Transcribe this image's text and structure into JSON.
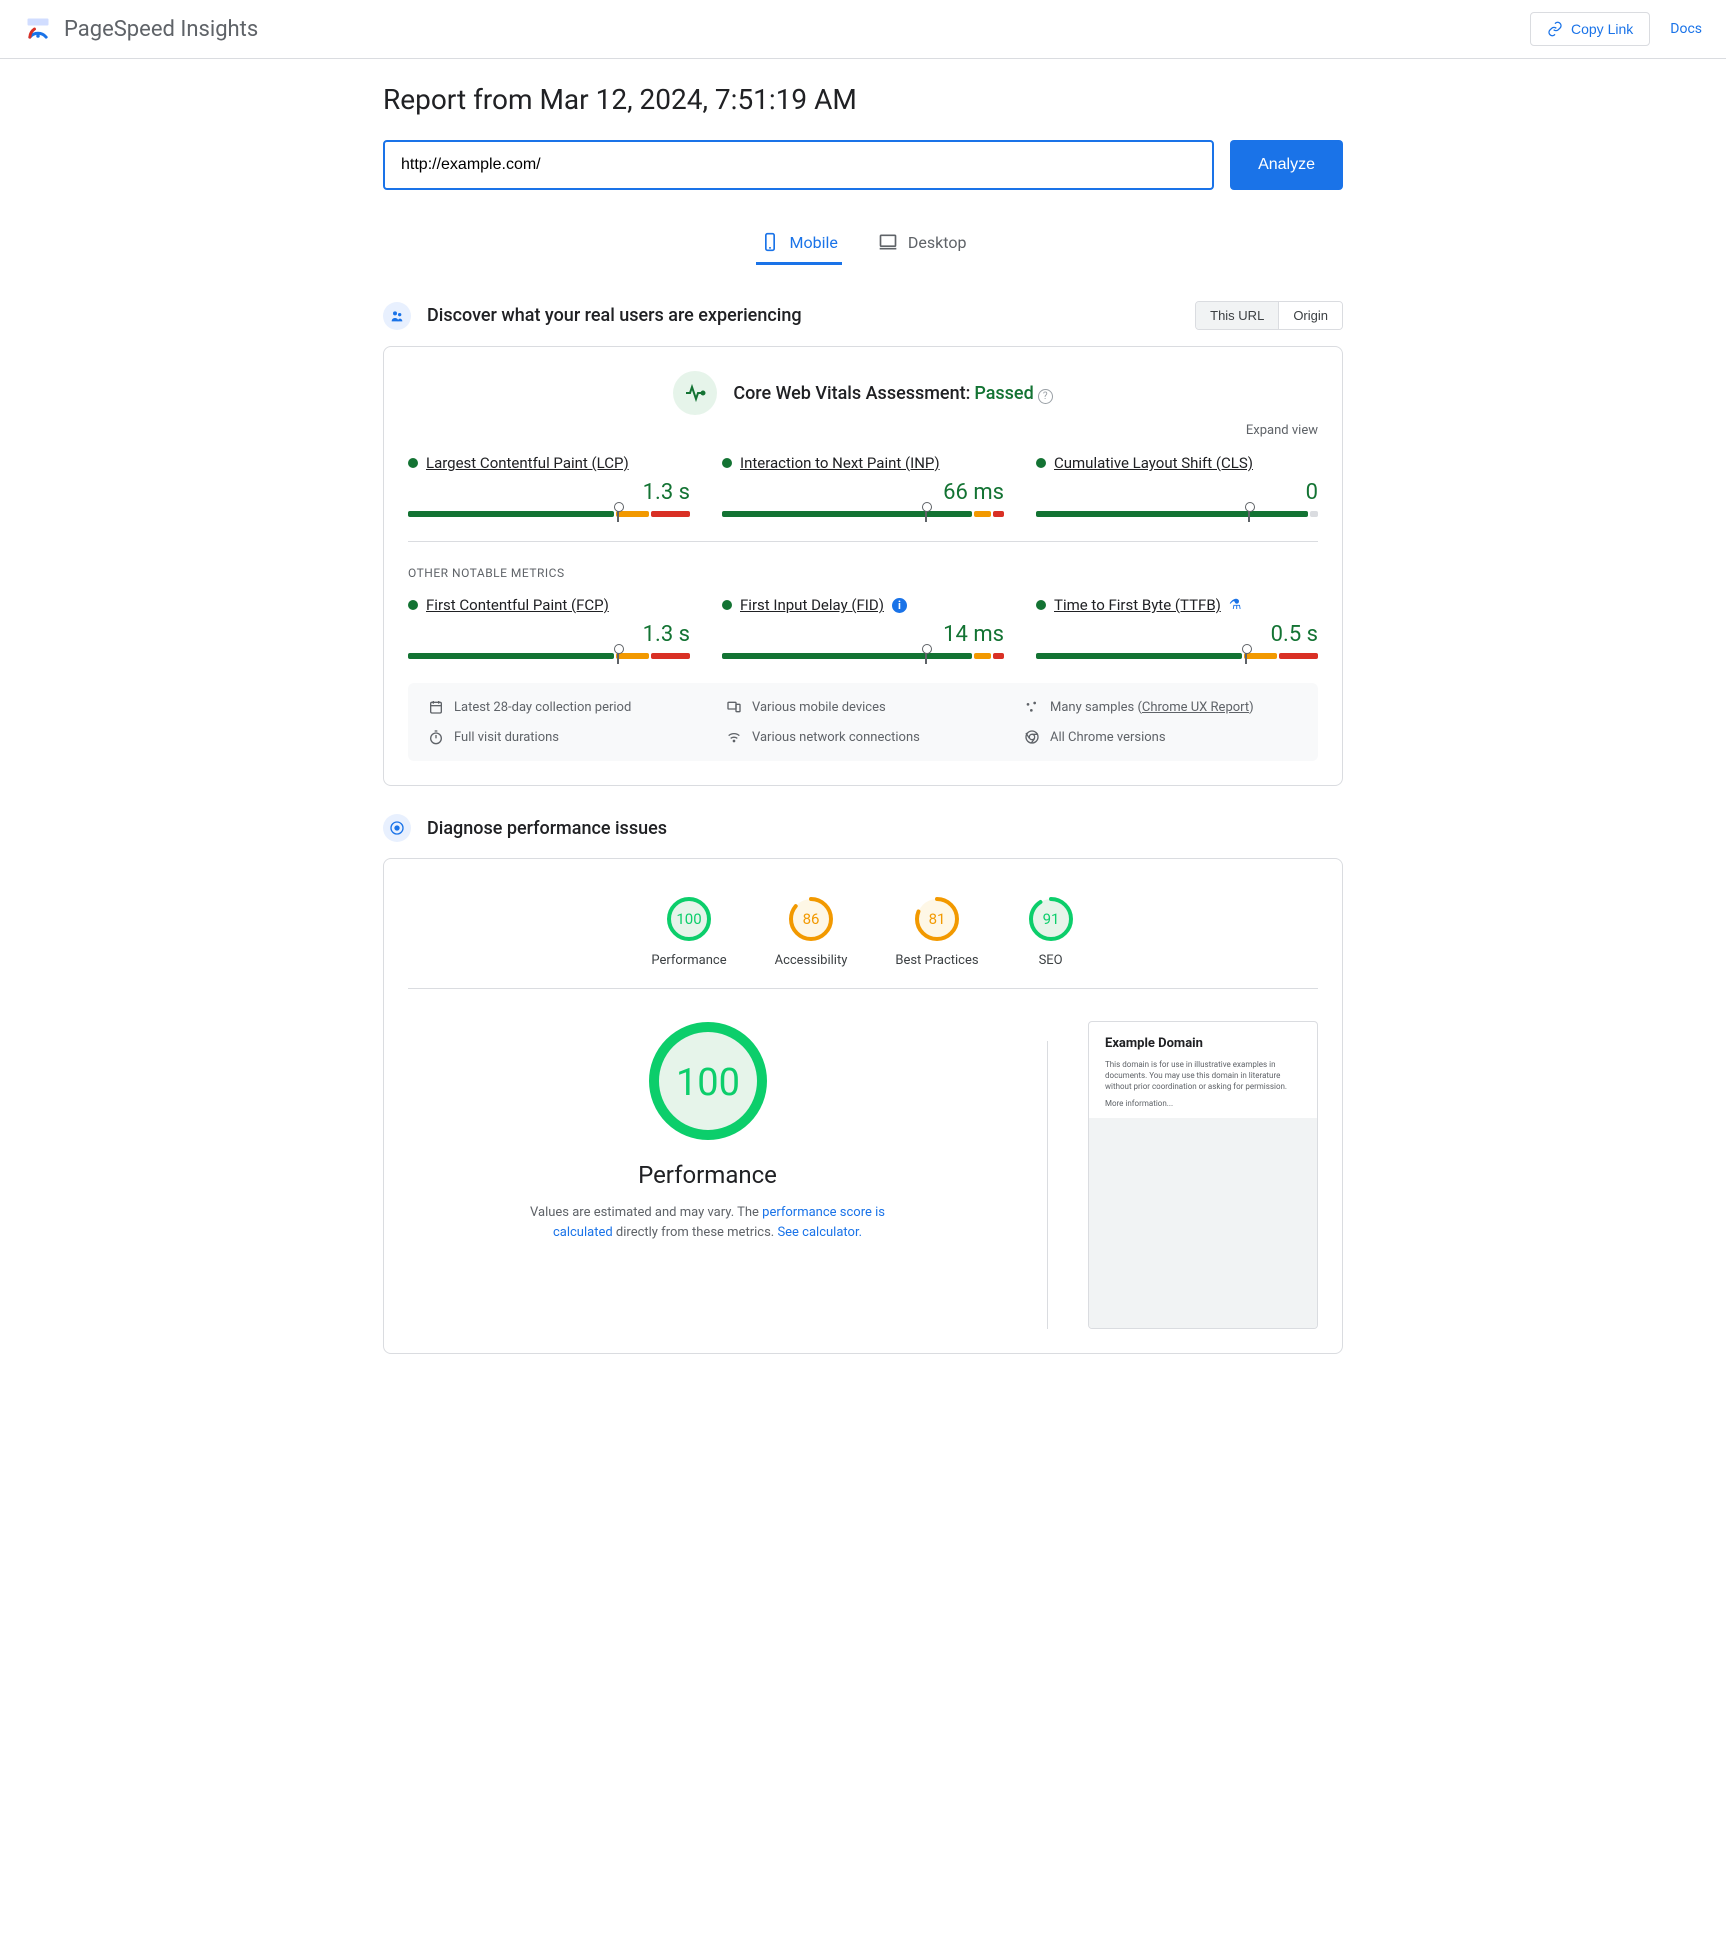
{
  "header": {
    "title": "PageSpeed Insights",
    "copy_link": "Copy Link",
    "docs": "Docs"
  },
  "report": {
    "title": "Report from Mar 12, 2024, 7:51:19 AM",
    "url_value": "http://example.com/",
    "analyze": "Analyze"
  },
  "tabs": {
    "mobile": "Mobile",
    "desktop": "Desktop"
  },
  "discover": {
    "title": "Discover what your real users are experiencing",
    "this_url": "This URL",
    "origin": "Origin"
  },
  "cwv": {
    "label": "Core Web Vitals Assessment:",
    "status": "Passed",
    "expand": "Expand view",
    "other_label": "OTHER NOTABLE METRICS",
    "metrics": {
      "lcp": {
        "name": "Largest Contentful Paint (LCP)",
        "value": "1.3 s",
        "dist": {
          "g": 74,
          "o": 12,
          "r": 14,
          "m": 74
        }
      },
      "inp": {
        "name": "Interaction to Next Paint (INP)",
        "value": "66 ms",
        "dist": {
          "g": 90,
          "o": 6,
          "r": 4,
          "m": 72
        }
      },
      "cls": {
        "name": "Cumulative Layout Shift (CLS)",
        "value": "0",
        "dist": {
          "g": 97,
          "o": 0,
          "r": 0,
          "gr": 3,
          "m": 75
        }
      },
      "fcp": {
        "name": "First Contentful Paint (FCP)",
        "value": "1.3 s",
        "dist": {
          "g": 74,
          "o": 12,
          "r": 14,
          "m": 74
        }
      },
      "fid": {
        "name": "First Input Delay (FID)",
        "value": "14 ms",
        "dist": {
          "g": 90,
          "o": 6,
          "r": 4,
          "m": 72
        }
      },
      "ttfb": {
        "name": "Time to First Byte (TTFB)",
        "value": "0.5 s",
        "dist": {
          "g": 74,
          "o": 12,
          "r": 14,
          "m": 74
        }
      }
    },
    "info": {
      "period": "Latest 28-day collection period",
      "devices": "Various mobile devices",
      "samples_pre": "Many samples (",
      "samples_link": "Chrome UX Report",
      "samples_post": ")",
      "durations": "Full visit durations",
      "networks": "Various network connections",
      "versions": "All Chrome versions"
    }
  },
  "diagnose": {
    "title": "Diagnose performance issues"
  },
  "gauges": {
    "performance": {
      "label": "Performance",
      "score": "100",
      "color": "#0cce6b",
      "bg": "#e6f4ea",
      "pct": 100
    },
    "accessibility": {
      "label": "Accessibility",
      "score": "86",
      "color": "#f29900",
      "bg": "#fef7e6",
      "pct": 86
    },
    "best_practices": {
      "label": "Best Practices",
      "score": "81",
      "color": "#f29900",
      "bg": "#fef7e6",
      "pct": 81
    },
    "seo": {
      "label": "SEO",
      "score": "91",
      "color": "#0cce6b",
      "bg": "#e6f4ea",
      "pct": 91
    }
  },
  "perf": {
    "heading": "Performance",
    "big_score": "100",
    "note_pre": "Values are estimated and may vary. The ",
    "note_link1": "performance score is calculated",
    "note_mid": " directly from these metrics. ",
    "note_link2": "See calculator.",
    "preview_title": "Example Domain",
    "preview_text": "This domain is for use in illustrative examples in documents. You may use this domain in literature without prior coordination or asking for permission.",
    "preview_link": "More information..."
  }
}
